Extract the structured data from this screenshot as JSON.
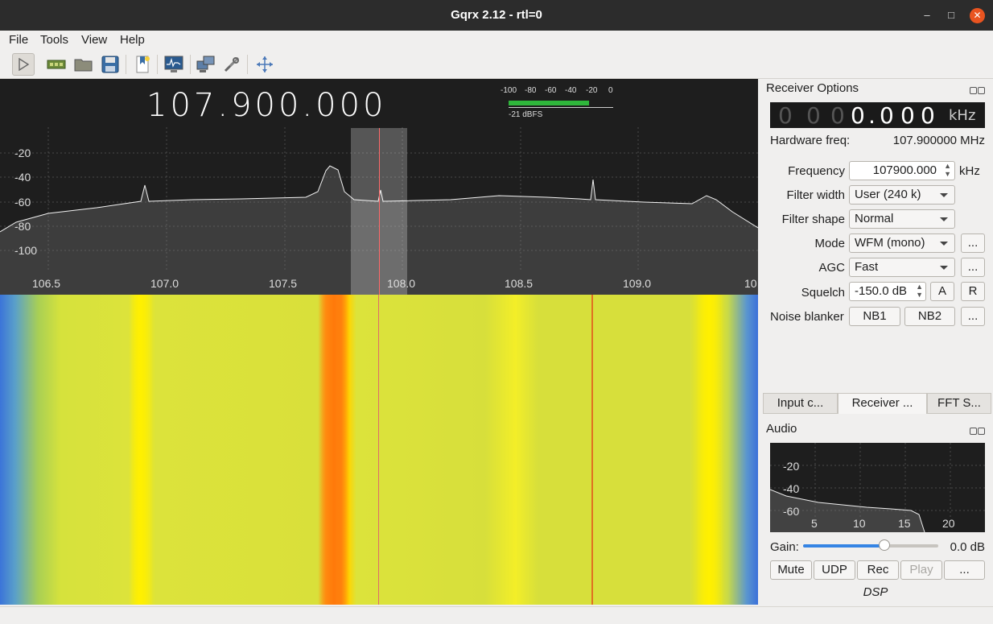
{
  "window": {
    "title": "Gqrx 2.12 - rtl=0"
  },
  "menu": [
    "File",
    "Tools",
    "View",
    "Help"
  ],
  "toolbar": {
    "icons": [
      "play-icon",
      "hardware-icon",
      "open-icon",
      "save-icon",
      "bookmark-icon",
      "fft-icon",
      "network-icon",
      "settings-icon",
      "fullscreen-icon"
    ]
  },
  "spectrum": {
    "frequency": "107.900.000",
    "meter": {
      "ticks": [
        "-100",
        "-80",
        "-60",
        "-40",
        "-20",
        "0"
      ],
      "level_label": "-21 dBFS",
      "level_dbfs": -21
    },
    "y_ticks": [
      "-20",
      "-40",
      "-60",
      "-80",
      "-100"
    ],
    "x_ticks": [
      "106.5",
      "107.0",
      "107.5",
      "108.0",
      "108.5",
      "109.0",
      "10"
    ]
  },
  "receiver_options": {
    "header": "Receiver Options",
    "lcd": {
      "dim_digits": [
        "0",
        "0",
        "0"
      ],
      "bright_digits": [
        "0",
        ".",
        "0",
        "0",
        "0"
      ],
      "unit": "kHz"
    },
    "hardware_freq_label": "Hardware freq:",
    "hardware_freq_value": "107.900000 MHz",
    "frequency_label": "Frequency",
    "frequency_value": "107900.000",
    "frequency_unit": "kHz",
    "filter_width_label": "Filter width",
    "filter_width_value": "User (240 k)",
    "filter_shape_label": "Filter shape",
    "filter_shape_value": "Normal",
    "mode_label": "Mode",
    "mode_value": "WFM (mono)",
    "agc_label": "AGC",
    "agc_value": "Fast",
    "squelch_label": "Squelch",
    "squelch_value": "-150.0 dB",
    "squelch_a": "A",
    "squelch_r": "R",
    "noise_blanker_label": "Noise blanker",
    "nb1": "NB1",
    "nb2": "NB2",
    "more": "..."
  },
  "tabs": [
    "Input c...",
    "Receiver ...",
    "FFT S..."
  ],
  "audio": {
    "header": "Audio",
    "y_ticks": [
      "-20",
      "-40",
      "-60"
    ],
    "x_ticks": [
      "5",
      "10",
      "15",
      "20"
    ],
    "gain_label": "Gain:",
    "gain_value": "0.0 dB",
    "gain_fraction": 0.6,
    "buttons": {
      "mute": "Mute",
      "udp": "UDP",
      "rec": "Rec",
      "play": "Play",
      "more": "..."
    },
    "dsp_label": "DSP"
  }
}
